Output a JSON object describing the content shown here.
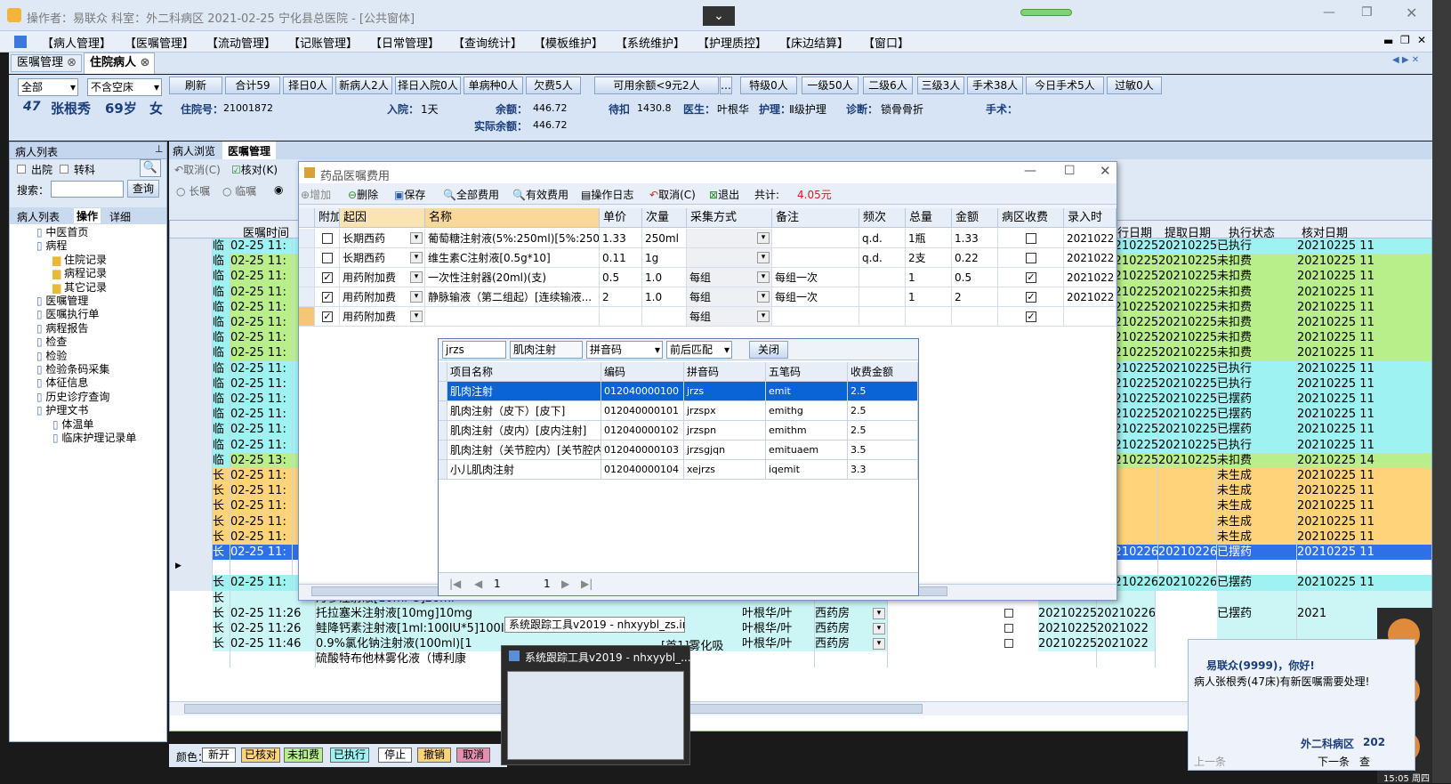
{
  "window": {
    "title": "操作者：易联众  科室：外二科病区  2021-02-25  宁化县总医院 - [公共窗体]"
  },
  "menu": [
    "【病人管理】",
    "【医嘱管理】",
    "【流动管理】",
    "【记账管理】",
    "【日常管理】",
    "【查询统计】",
    "【模板维护】",
    "【系统维护】",
    "【护理质控】",
    "【床边结算】",
    "【窗口】"
  ],
  "tabs": [
    "医嘱管理",
    "住院病人"
  ],
  "toolbar": {
    "filter1": "全部",
    "filter2": "不含空床",
    "refresh": "刷新",
    "buttons": [
      "合计59",
      "择日0人",
      "新病人2人",
      "择日入院0人",
      "单病种0人",
      "欠费5人"
    ],
    "balance": "可用余额<9元2人",
    "buttons2": [
      "特级0人",
      "一级50人",
      "二级6人",
      "三级3人",
      "手术38人",
      "今日手术5人",
      "过敏0人"
    ]
  },
  "patient": {
    "bed": "47",
    "name": "张根秀",
    "age": "69岁",
    "sex": "女",
    "adm_label": "住院号：",
    "adm_no": "21001872",
    "in_label": "入院：",
    "in_days": "1天",
    "bal_label": "余额：",
    "bal": "446.72",
    "rbal_label": "实际余额：",
    "rbal": "446.72",
    "pending_label": "待扣",
    "pending": "1430.8",
    "doc_label": "医生：",
    "doc": "叶根华",
    "nurse_label": "护理：",
    "nurse": "Ⅱ级护理",
    "diag_label": "诊断：",
    "diag": "锁骨骨折",
    "surg_label": "手术："
  },
  "left": {
    "title": "病人列表",
    "pin": "⊥",
    "out": "出院",
    "transfer": "转科",
    "search_label": "搜索：",
    "query": "查询",
    "tabs": [
      "病人列表",
      "操作",
      "详细"
    ],
    "tree": [
      "中医首页",
      "病程",
      "住院记录",
      "病程记录",
      "其它记录",
      "医嘱管理",
      "医嘱执行单",
      "病程报告",
      "检查",
      "检验",
      "检验条码采集",
      "体征信息",
      "历史诊疗查询",
      "护理文书",
      "体温单",
      "临床护理记录单"
    ]
  },
  "subtabs": [
    "病人浏览",
    "医嘱管理"
  ],
  "subtool": [
    "取消(C)",
    "核对(K)"
  ],
  "ordertype": [
    "长嘱",
    "临嘱"
  ],
  "grid": {
    "headers": [
      "医嘱时间",
      "执行日期",
      "提取日期",
      "执行状态",
      "核对日期"
    ],
    "rows": [
      [
        "临",
        "02-25 11:",
        "20210225",
        "20210225",
        "已执行",
        "20210225 11",
        "#9ff2f2"
      ],
      [
        "临",
        "02-25 11:",
        "20210225",
        "20210225",
        "未扣费",
        "20210225 11",
        "#b8ef8a"
      ],
      [
        "临",
        "02-25 11:",
        "20210225",
        "20210225",
        "未扣费",
        "20210225 11",
        "#b8ef8a"
      ],
      [
        "临",
        "02-25 11:",
        "20210225",
        "20210225",
        "未扣费",
        "20210225 11",
        "#b8ef8a"
      ],
      [
        "临",
        "02-25 11:",
        "20210225",
        "20210225",
        "未扣费",
        "20210225 11",
        "#b8ef8a"
      ],
      [
        "临",
        "02-25 11:",
        "20210225",
        "20210225",
        "未扣费",
        "20210225 11",
        "#b8ef8a"
      ],
      [
        "临",
        "02-25 11:",
        "20210225",
        "20210225",
        "未扣费",
        "20210225 11",
        "#b8ef8a"
      ],
      [
        "临",
        "02-25 11:",
        "20210225",
        "20210225",
        "未扣费",
        "20210225 11",
        "#b8ef8a"
      ],
      [
        "临",
        "02-25 11:",
        "20210225",
        "20210225",
        "已执行",
        "20210225 11",
        "#9ff2f2"
      ],
      [
        "临",
        "02-25 11:",
        "20210225",
        "20210225",
        "已执行",
        "20210225 11",
        "#9ff2f2"
      ],
      [
        "临",
        "02-25 11:",
        "20210225",
        "20210225",
        "已摆药",
        "20210225 11",
        "#9ff2f2"
      ],
      [
        "临",
        "02-25 11:",
        "20210225",
        "20210225",
        "已摆药",
        "20210225 11",
        "#9ff2f2"
      ],
      [
        "临",
        "02-25 11:",
        "20210225",
        "20210225",
        "已摆药",
        "20210225 11",
        "#9ff2f2"
      ],
      [
        "临",
        "02-25 11:",
        "20210225",
        "20210225",
        "已执行",
        "20210225 11",
        "#9ff2f2"
      ],
      [
        "临",
        "02-25 13:",
        "20210225",
        "20210225",
        "未扣费",
        "20210225 14",
        "#b8ef8a"
      ],
      [
        "长",
        "02-25 11:",
        "",
        "",
        "未生成",
        "20210225 11",
        "#ffd37a"
      ],
      [
        "长",
        "02-25 11:",
        "",
        "",
        "未生成",
        "20210225 11",
        "#ffd37a"
      ],
      [
        "长",
        "02-25 11:",
        "",
        "",
        "未生成",
        "20210225 11",
        "#ffd37a"
      ],
      [
        "长",
        "02-25 11:",
        "",
        "",
        "未生成",
        "20210225 11",
        "#ffd37a"
      ],
      [
        "长",
        "02-25 11:",
        "",
        "",
        "未生成",
        "20210225 11",
        "#ffd37a"
      ],
      [
        "长",
        "02-25 11:",
        "20210226",
        "20210226",
        "已摆药",
        "20210225 11",
        "#2f6fe8"
      ],
      [
        "",
        "",
        "",
        "",
        "",
        "",
        ""
      ],
      [
        "长",
        "02-25 11:",
        "20210226",
        "20210226",
        "已摆药",
        "20210225 11",
        "#9ff2f2"
      ]
    ],
    "bottom": [
      {
        "t": "长",
        "time": "",
        "name": "丹参注射液[10ml*5]20ml",
        "doc": "",
        "ph": "",
        "ed": "",
        "pd": "",
        "st": "",
        "cd": ""
      },
      {
        "t": "长",
        "time": "02-25 11:26",
        "name": "托拉塞米注射液[10mg]10mg",
        "doc": "叶根华/叶",
        "ph": "西药房",
        "ed": "20210225",
        "pd": "20210226",
        "st": "已摆药",
        "cd": "2021"
      },
      {
        "t": "长",
        "time": "02-25 11:26",
        "name": "鲑降钙素注射液[1ml:100IU*5]100IU",
        "doc": "叶根华/叶",
        "ph": "西药房",
        "ed": "20210225",
        "pd": "2021022",
        "st": "",
        "cd": ""
      },
      {
        "t": "长",
        "time": "02-25 11:46",
        "name": "0.9%氯化钠注射液(100ml)[1",
        "doc": "叶根华/叶",
        "ph": "西药房",
        "ed": "20210225",
        "pd": "2021022",
        "st": "",
        "cd": ""
      },
      {
        "t": "",
        "time": "",
        "name": "硫酸特布他林雾化液（博利康",
        "doc": "",
        "ph": "",
        "ed": "",
        "pd": "",
        "st": "",
        "cd": ""
      }
    ],
    "extra": "[首1]雾化吸"
  },
  "legend": {
    "label": "颜色：",
    "items": [
      [
        "新开",
        "#ffffff"
      ],
      [
        "已核对",
        "#ffd37a"
      ],
      [
        "未扣费",
        "#b8ef8a"
      ],
      [
        "已执行",
        "#9ff2f2"
      ],
      [
        "停止",
        "#ffffff"
      ],
      [
        "撤销",
        "#ffd37a"
      ],
      [
        "取消",
        "#e38fb0"
      ]
    ]
  },
  "dialog": {
    "title": "药品医嘱费用",
    "toolbar": [
      "增加",
      "删除",
      "保存",
      "全部费用",
      "有效费用",
      "操作日志",
      "取消(C)",
      "退出"
    ],
    "total_label": "共计:",
    "total": "4.05元",
    "headers": [
      "附加",
      "起因",
      "名称",
      "单价",
      "次量",
      "采集方式",
      "备注",
      "频次",
      "总量",
      "金额",
      "病区收费",
      "录入时"
    ],
    "rows": [
      {
        "chk": false,
        "cause": "长期西药",
        "name": "葡萄糖注射液(5%:250ml)[5%:250ml]",
        "price": "1.33",
        "dose": "250ml",
        "mode": "",
        "note": "",
        "freq": "q.d.",
        "total": "1瓶",
        "amount": "1.33",
        "fee": false,
        "date": "2021022"
      },
      {
        "chk": false,
        "cause": "长期西药",
        "name": "维生素C注射液[0.5g*10]",
        "price": "0.11",
        "dose": "1g",
        "mode": "",
        "note": "",
        "freq": "q.d.",
        "total": "2支",
        "amount": "0.22",
        "fee": false,
        "date": "2021022"
      },
      {
        "chk": true,
        "cause": "用药附加费",
        "name": "一次性注射器(20ml)(支)",
        "price": "0.5",
        "dose": "1.0",
        "mode": "每组",
        "note": "每组一次",
        "freq": "",
        "total": "1",
        "amount": "0.5",
        "fee": true,
        "date": "2021022"
      },
      {
        "chk": true,
        "cause": "用药附加费",
        "name": "静脉输液（第二组起）[连续输液...",
        "price": "2",
        "dose": "1.0",
        "mode": "每组",
        "note": "每组一次",
        "freq": "",
        "total": "1",
        "amount": "2",
        "fee": true,
        "date": "2021022"
      },
      {
        "chk": true,
        "cause": "用药附加费",
        "name": "",
        "price": "",
        "dose": "",
        "mode": "每组",
        "note": "",
        "freq": "",
        "total": "",
        "amount": "",
        "fee": true,
        "date": ""
      }
    ]
  },
  "popup": {
    "query": "jrzs",
    "query_name": "肌肉注射",
    "code_type": "拼音码",
    "match": "前后匹配",
    "close": "关闭",
    "headers": [
      "项目名称",
      "编码",
      "拼音码",
      "五笔码",
      "收费金额"
    ],
    "rows": [
      [
        "肌肉注射",
        "012040000100",
        "jrzs",
        "emit",
        "2.5"
      ],
      [
        "肌肉注射（皮下）[皮下]",
        "012040000101",
        "jrzspx",
        "emithg",
        "2.5"
      ],
      [
        "肌肉注射（皮内）[皮内注射]",
        "012040000102",
        "jrzspn",
        "emithm",
        "2.5"
      ],
      [
        "肌肉注射（关节腔内）[关节腔内注射]",
        "012040000103",
        "jrzsgjqn",
        "emituaem",
        "3.5"
      ],
      [
        "小儿肌肉注射",
        "012040000104",
        "xejrzs",
        "iqemit",
        "3.3"
      ]
    ],
    "page": "1",
    "page2": "1"
  },
  "taskbar": {
    "tooltip": "系统跟踪工具v2019 - nhxyybl_zs.ini",
    "thumb_title": "系统跟踪工具v2019 - nhxyybl_..."
  },
  "notify": {
    "greeting": "易联众(9999)，你好!",
    "msg": "病人张根秀(47床)有新医嘱需要处理!",
    "dept": "外二科病区",
    "date": "202",
    "prev": "上一条",
    "next": "下一条",
    "view": "查"
  },
  "clock": "15:05 周四"
}
